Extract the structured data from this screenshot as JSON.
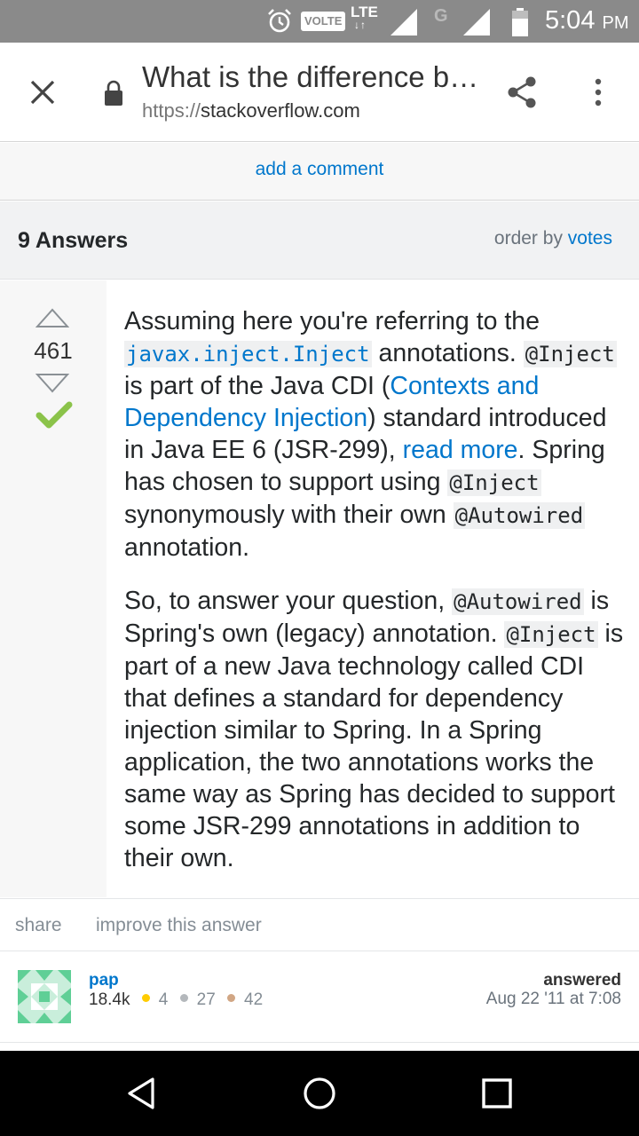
{
  "status_bar": {
    "volte": "VOLTE",
    "lte": "LTE",
    "g": "G",
    "time": "5:04",
    "ampm": "PM"
  },
  "toolbar": {
    "title": "What is the difference b…",
    "url_scheme": "https://",
    "url_host": "stackoverflow.com",
    "icons": [
      "close-icon",
      "lock-icon",
      "share-icon",
      "more-vert-icon"
    ]
  },
  "comment": {
    "add_label": "add a comment"
  },
  "answers": {
    "count_label": "9 Answers",
    "order_label": "order by",
    "order_value": "votes"
  },
  "answer": {
    "votes": "461",
    "accepted": true,
    "p1": {
      "t1": "Assuming here you're referring to the ",
      "c1": "javax.inject.Inject",
      "t2": " annotations. ",
      "c2": "@Inject",
      "t3": " is part of the Java CDI (",
      "l1": "Contexts and Dependency Injection",
      "t4": ") standard introduced in Java EE 6 (JSR-299), ",
      "l2": "read more",
      "t5": ". Spring has chosen to support using ",
      "c3": "@Inject",
      "t6": " synonymously with their own ",
      "c4": "@Autowired",
      "t7": " annotation."
    },
    "p2": {
      "t1": "So, to answer your question, ",
      "c1": "@Autowired",
      "t2": " is Spring's own (legacy) annotation. ",
      "c2": "@Inject",
      "t3": " is part of a new Java technology called CDI that defines a standard for dependency injection similar to Spring. In a Spring application, the two annotations works the same way as Spring has decided to support some JSR-299 annotations in addition to their own."
    },
    "actions": {
      "share": "share",
      "improve": "improve this answer"
    },
    "user": {
      "name": "pap",
      "reputation": "18.4k",
      "gold": "4",
      "silver": "27",
      "bronze": "42",
      "answered_label": "answered",
      "answered_date": "Aug 22 '11 at 7:08"
    }
  },
  "colors": {
    "link": "#0077cc",
    "accepted": "#8bc34a",
    "status_bar": "#8a8a8a",
    "gold": "#ffcc01",
    "silver": "#b4b8bc",
    "bronze": "#d1a684"
  },
  "nav": {
    "icons": [
      "back-icon",
      "home-icon",
      "recents-icon"
    ]
  }
}
